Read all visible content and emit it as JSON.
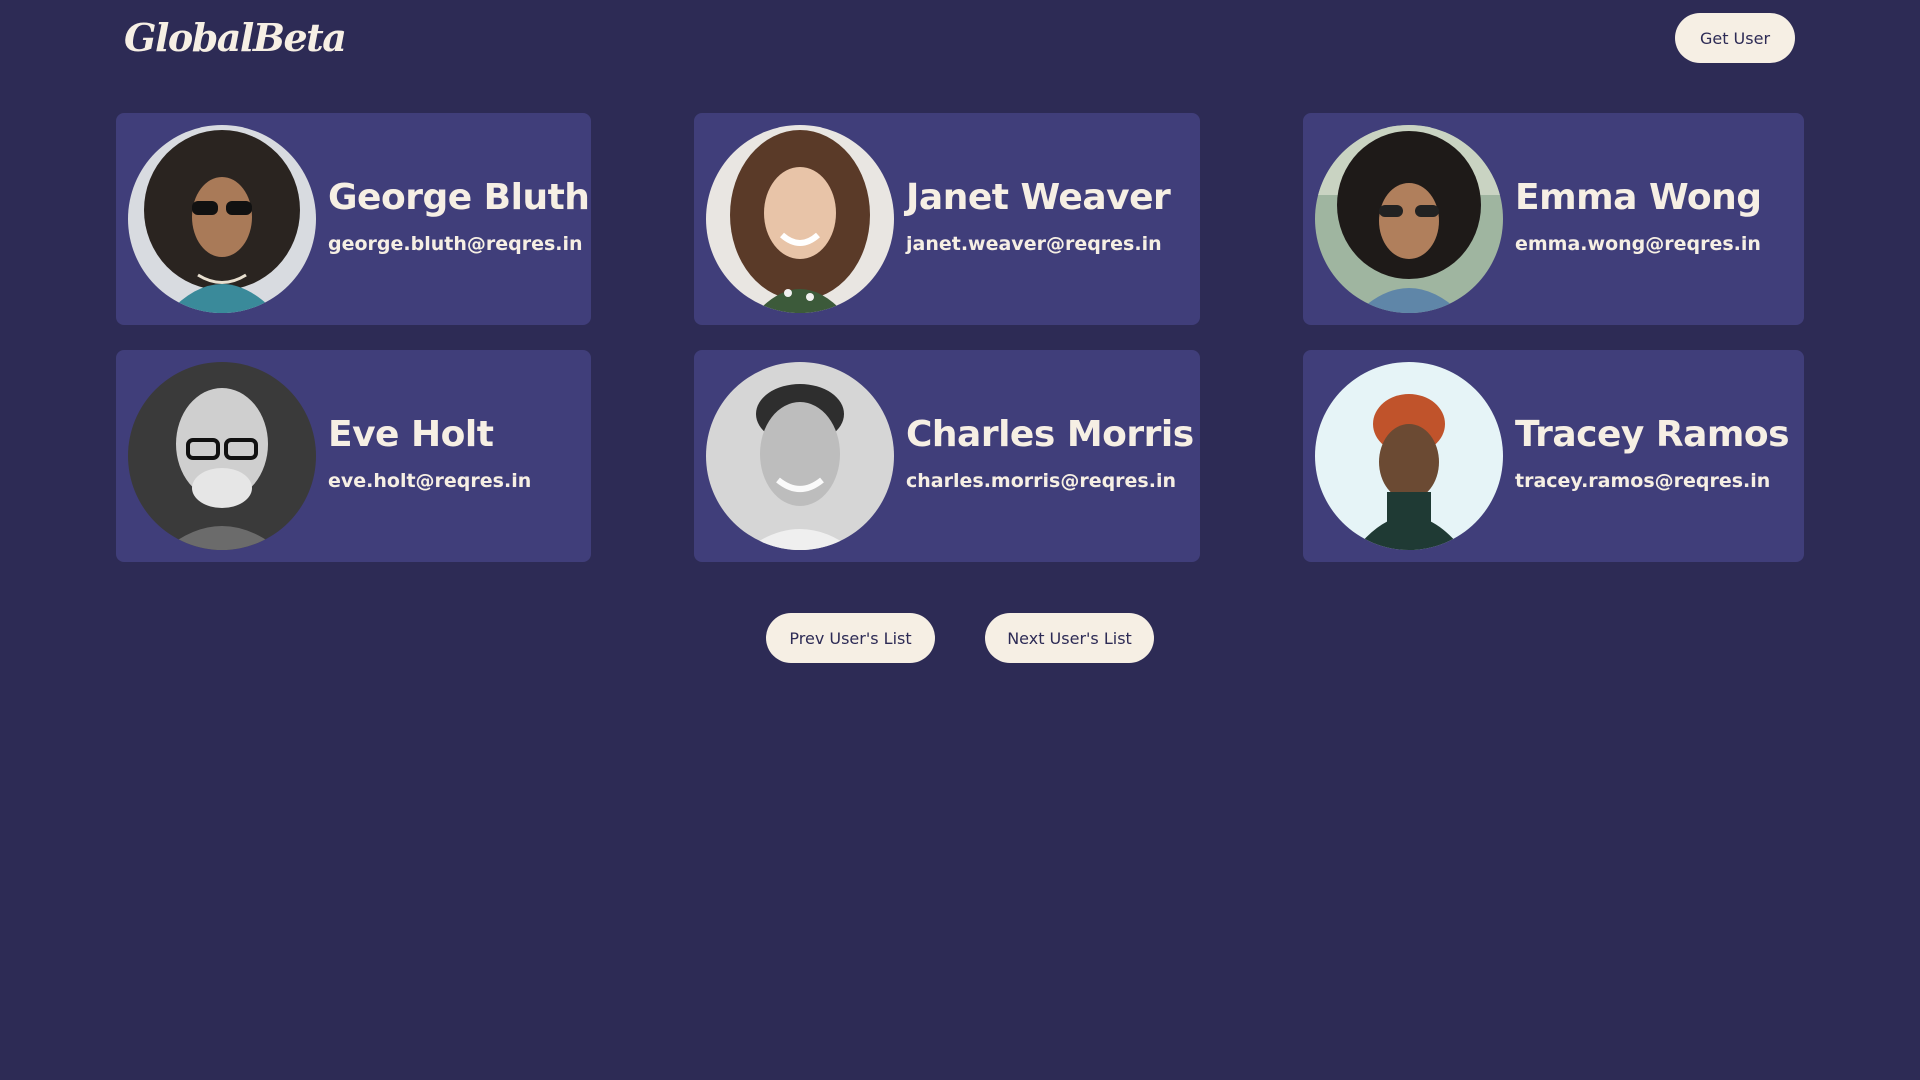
{
  "header": {
    "logo_text": "GlobalBeta",
    "get_user_label": "Get User"
  },
  "users": [
    {
      "name": "George Bluth",
      "email": "george.bluth@reqres.in"
    },
    {
      "name": "Janet Weaver",
      "email": "janet.weaver@reqres.in"
    },
    {
      "name": "Emma Wong",
      "email": "emma.wong@reqres.in"
    },
    {
      "name": "Eve Holt",
      "email": "eve.holt@reqres.in"
    },
    {
      "name": "Charles Morris",
      "email": "charles.morris@reqres.in"
    },
    {
      "name": "Tracey Ramos",
      "email": "tracey.ramos@reqres.in"
    }
  ],
  "pagination": {
    "prev_label": "Prev User's List",
    "next_label": "Next User's List"
  },
  "colors": {
    "background": "#2d2b55",
    "card": "#403e7a",
    "accent": "#f6efe4"
  }
}
